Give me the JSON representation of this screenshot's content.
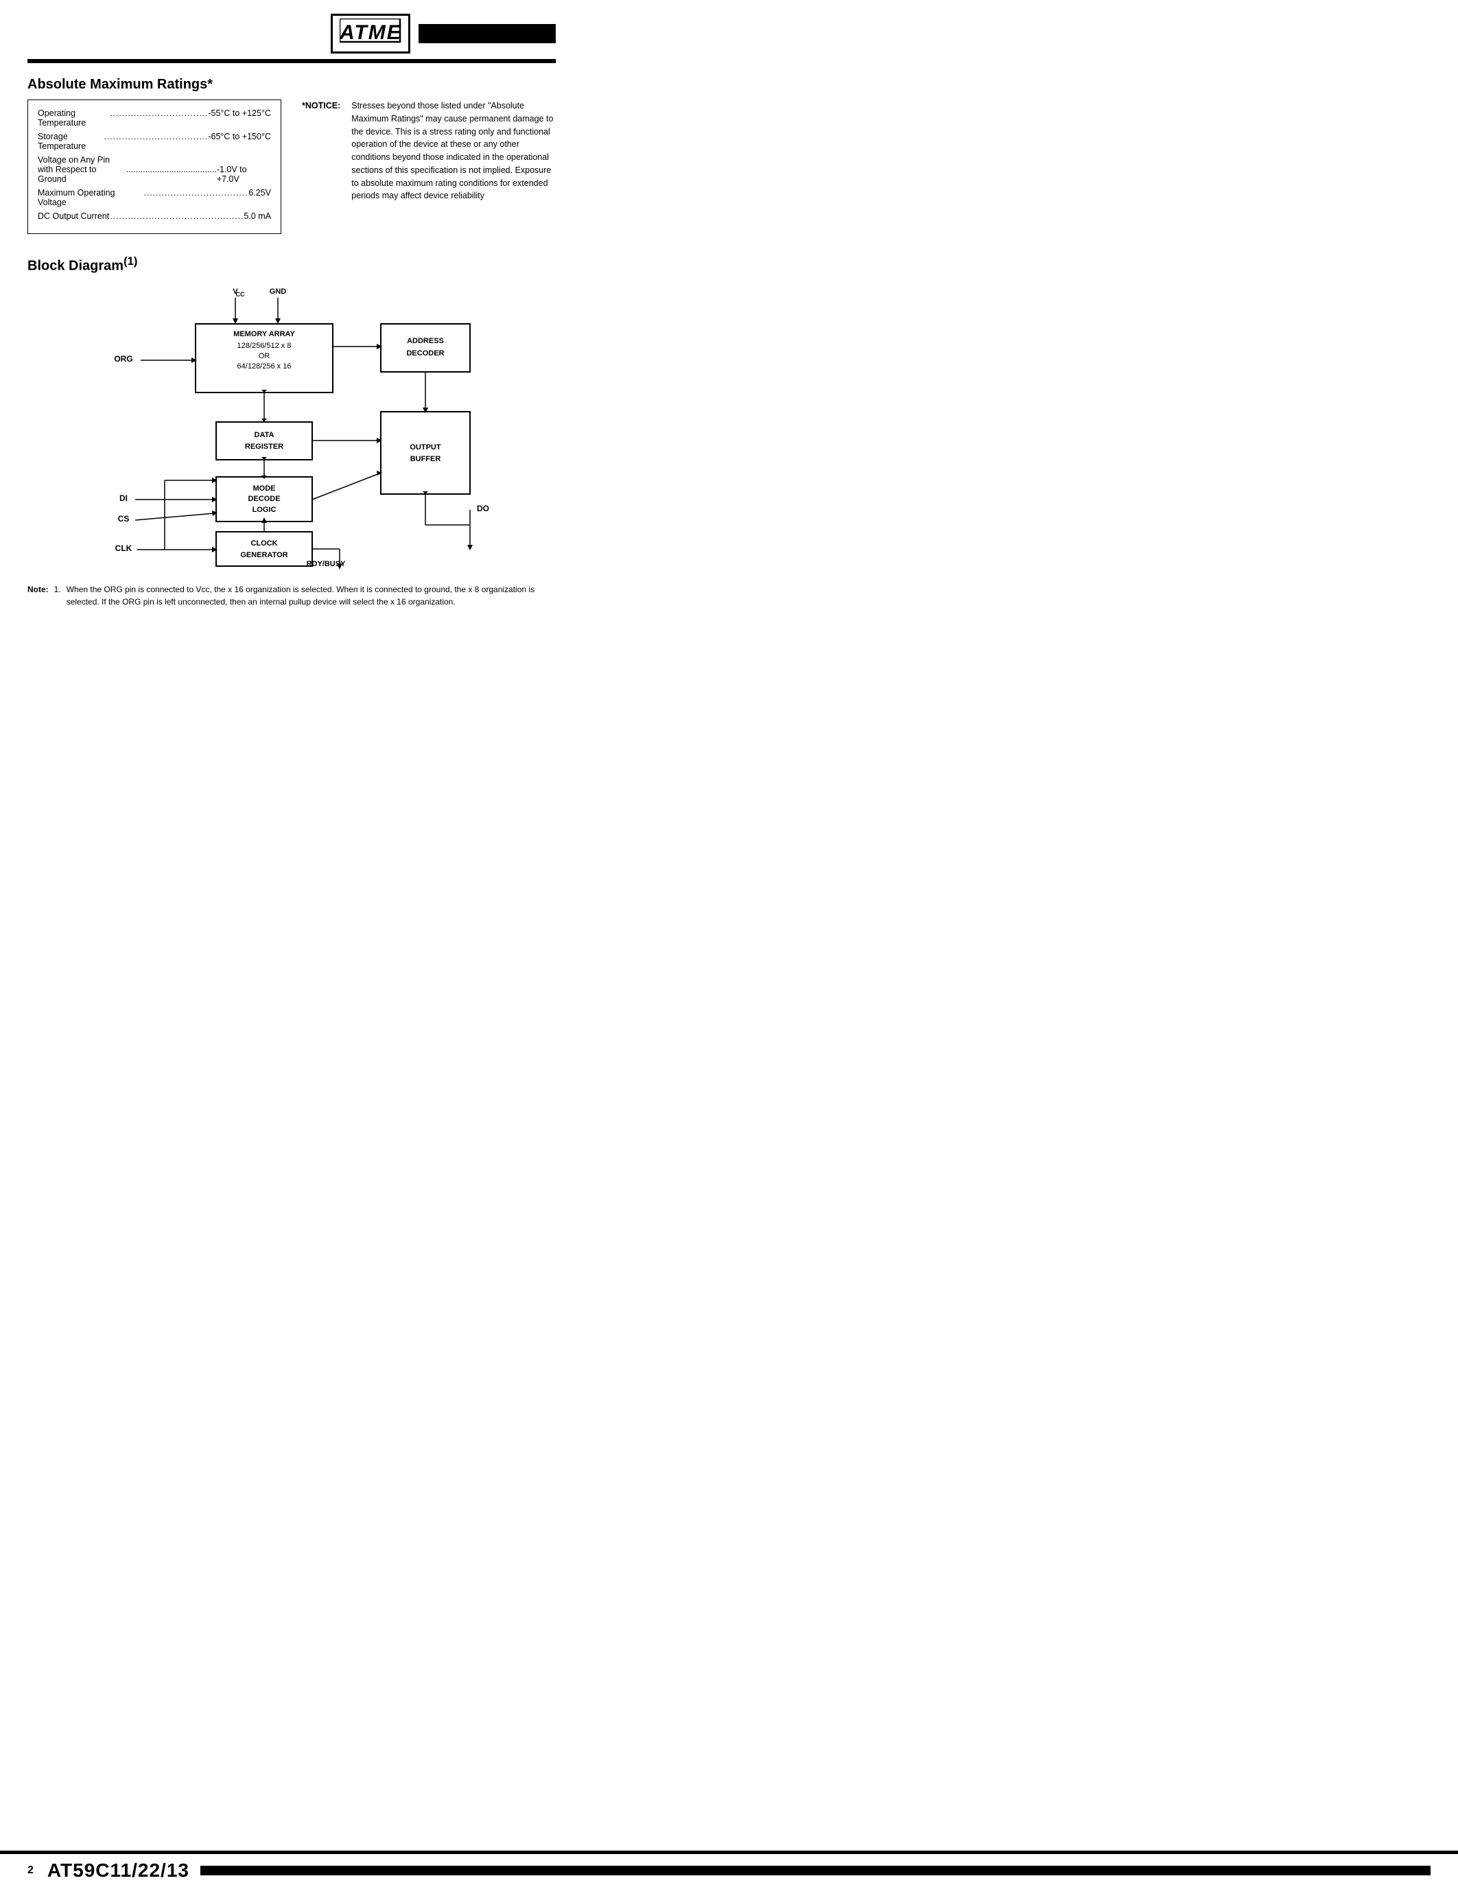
{
  "header": {
    "logo_text": "ATMEL",
    "logo_alt": "Atmel Logo"
  },
  "absolute_max_ratings": {
    "title": "Absolute Maximum Ratings*",
    "box_rows": [
      {
        "label": "Operating Temperature",
        "dots": "................................",
        "value": "-55°C to +125°C"
      },
      {
        "label": "Storage Temperature",
        "dots": "...................................",
        "value": "-65°C to +150°C"
      },
      {
        "label": "Voltage on Any Pin\nwith Respect to Ground",
        "dots": "....................................",
        "value": "-1.0V to +7.0V"
      },
      {
        "label": "Maximum Operating Voltage",
        "dots": "........................................",
        "value": "6.25V"
      },
      {
        "label": "DC Output Current",
        "dots": ".................................................",
        "value": "5.0 mA"
      }
    ],
    "notice_label": "*NOTICE:",
    "notice_text": "Stresses beyond those listed under \"Absolute Maximum Ratings\" may cause permanent damage to the device. This is a stress rating only and functional operation of the device at these or any other conditions beyond those indicated in the operational sections of this specification is not implied. Exposure to absolute maximum rating conditions for extended periods may affect device reliability"
  },
  "block_diagram": {
    "title": "Block Diagram",
    "superscript": "(1)",
    "labels": {
      "vcc": "VⳀⲜ",
      "gnd": "GND",
      "org": "ORG",
      "di": "DI",
      "cs": "CS",
      "clk": "CLK",
      "do": "DO",
      "rdy_busy": "RDY/BUSY"
    },
    "boxes": {
      "memory_array": {
        "line1": "MEMORY ARRAY",
        "line2": "128/256/512 x 8",
        "line3": "OR",
        "line4": "64/128/256 x 16"
      },
      "address_decoder": {
        "line1": "ADDRESS",
        "line2": "DECODER"
      },
      "data_register": {
        "line1": "DATA",
        "line2": "REGISTER"
      },
      "output_buffer": {
        "line1": "OUTPUT",
        "line2": "BUFFER"
      },
      "mode_decode_logic": {
        "line1": "MODE",
        "line2": "DECODE",
        "line3": "LOGIC"
      },
      "clock_generator": {
        "line1": "CLOCK",
        "line2": "GENERATOR"
      }
    }
  },
  "note": {
    "label": "Note:",
    "number": "1.",
    "text": "When the ORG pin is connected to Vᴄᴄ, the x 16 organization is selected. When it is connected to ground, the x 8 organization is selected. If the ORG pin is left unconnected, then an internal pullup device will select the x 16 organization."
  },
  "footer": {
    "page_number": "2",
    "chip_title": "AT59C11/22/13"
  }
}
